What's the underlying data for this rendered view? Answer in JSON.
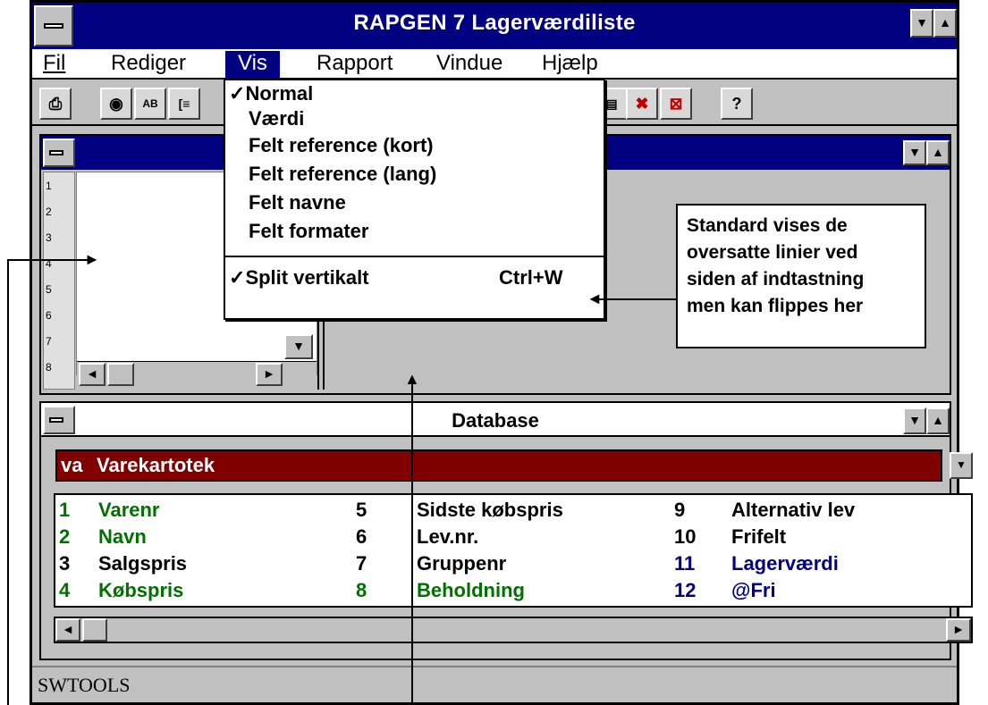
{
  "window": {
    "title": "RAPGEN 7 Lagerværdiliste"
  },
  "menu": {
    "items": [
      "Fil",
      "Rediger",
      "Vis",
      "Rapport",
      "Vindue",
      "Hjælp"
    ]
  },
  "vis_menu": {
    "items": [
      {
        "label": "Normal",
        "checked": true
      },
      {
        "label": "Værdi"
      },
      {
        "label": "Felt reference (kort)"
      },
      {
        "label": "Felt reference (lang)"
      },
      {
        "label": "Felt navne"
      },
      {
        "label": "Felt formater"
      },
      {
        "label": "Split vertikalt",
        "checked": true,
        "shortcut": "Ctrl+W"
      }
    ]
  },
  "callout": {
    "lines": [
      "Standard vises de",
      "oversatte linier ved",
      "siden af indtastning",
      "men kan flippes her"
    ]
  },
  "ruler": {
    "numbers": [
      "1",
      "2",
      "3",
      "4",
      "5",
      "6",
      "7",
      "8"
    ]
  },
  "database_panel": {
    "title": "Database",
    "selected": {
      "code": "va",
      "name": "Varekartotek"
    },
    "fields": [
      {
        "num": "1",
        "name": "Varenr",
        "color": "#007000"
      },
      {
        "num": "2",
        "name": "Navn",
        "color": "#007000"
      },
      {
        "num": "3",
        "name": "Salgspris",
        "color": "#000000"
      },
      {
        "num": "4",
        "name": "Købspris",
        "color": "#007000"
      },
      {
        "num": "5",
        "name": "Sidste købspris",
        "color": "#000000"
      },
      {
        "num": "6",
        "name": "Lev.nr.",
        "color": "#000000"
      },
      {
        "num": "7",
        "name": "Gruppenr",
        "color": "#000000"
      },
      {
        "num": "8",
        "name": "Beholdning",
        "color": "#007000"
      },
      {
        "num": "9",
        "name": "Alternativ lev",
        "color": "#000000"
      },
      {
        "num": "10",
        "name": "Frifelt",
        "color": "#000000"
      },
      {
        "num": "11",
        "name": "Lagerværdi",
        "color": "#000080"
      },
      {
        "num": "12",
        "name": "@Fri",
        "color": "#000080"
      }
    ]
  },
  "status": {
    "text": "SWTOOLS"
  },
  "icons": {
    "print": "printer-icon",
    "help": "help-icon",
    "scroll_down": "arrow-down-icon",
    "scroll_up": "arrow-up-icon",
    "scroll_left": "arrow-left-icon",
    "scroll_right": "arrow-right-icon"
  },
  "colors": {
    "titlebar": "#000080",
    "db_select": "#800000",
    "field_green": "#007000",
    "field_blue": "#000080"
  }
}
